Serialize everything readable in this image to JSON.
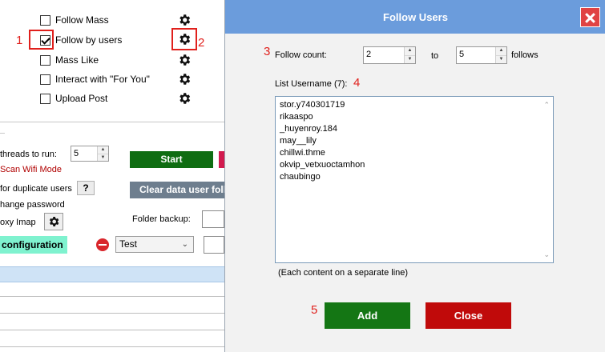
{
  "menu": {
    "items": [
      {
        "label": "Follow Mass",
        "checked": false
      },
      {
        "label": "Follow by users",
        "checked": true
      },
      {
        "label": "Mass Like",
        "checked": false
      },
      {
        "label": "Interact with \"For You\"",
        "checked": false
      },
      {
        "label": "Upload Post",
        "checked": false
      }
    ]
  },
  "annotations": {
    "n1": "1",
    "n2": "2",
    "n3": "3",
    "n4": "4",
    "n5": "5",
    "color": "#e0201c"
  },
  "bg": {
    "threads_label": "threads to run:",
    "threads_value": "5",
    "scan_wifi_label": "Scan Wifi Mode",
    "duplicate_label": "for duplicate users",
    "duplicate_help": "?",
    "change_password_label": "hange password",
    "proxy_label": "oxy Imap",
    "start_button": "Start",
    "clear_button": "Clear data user foll",
    "folder_backup_label": "Folder backup:",
    "configuration_button": "configuration",
    "profile_select": "Test"
  },
  "dialog": {
    "title": "Follow Users",
    "follow_count_label": "Follow count:",
    "from_value": "2",
    "to_label": "to",
    "to_value": "5",
    "follows_label": "follows",
    "list_label": "List Username (7):",
    "usernames": [
      "stor.y740301719",
      "rikaaspo",
      "_huyenroy.184",
      "may__lily",
      "chillwi.thme",
      "okvip_vetxuoctamhon",
      "chaubingo"
    ],
    "hint": "(Each content on a separate line)",
    "add_button": "Add",
    "close_button": "Close",
    "colors": {
      "titlebar": "#6b9cdc",
      "add": "#147614",
      "close": "#c00a0a"
    }
  }
}
